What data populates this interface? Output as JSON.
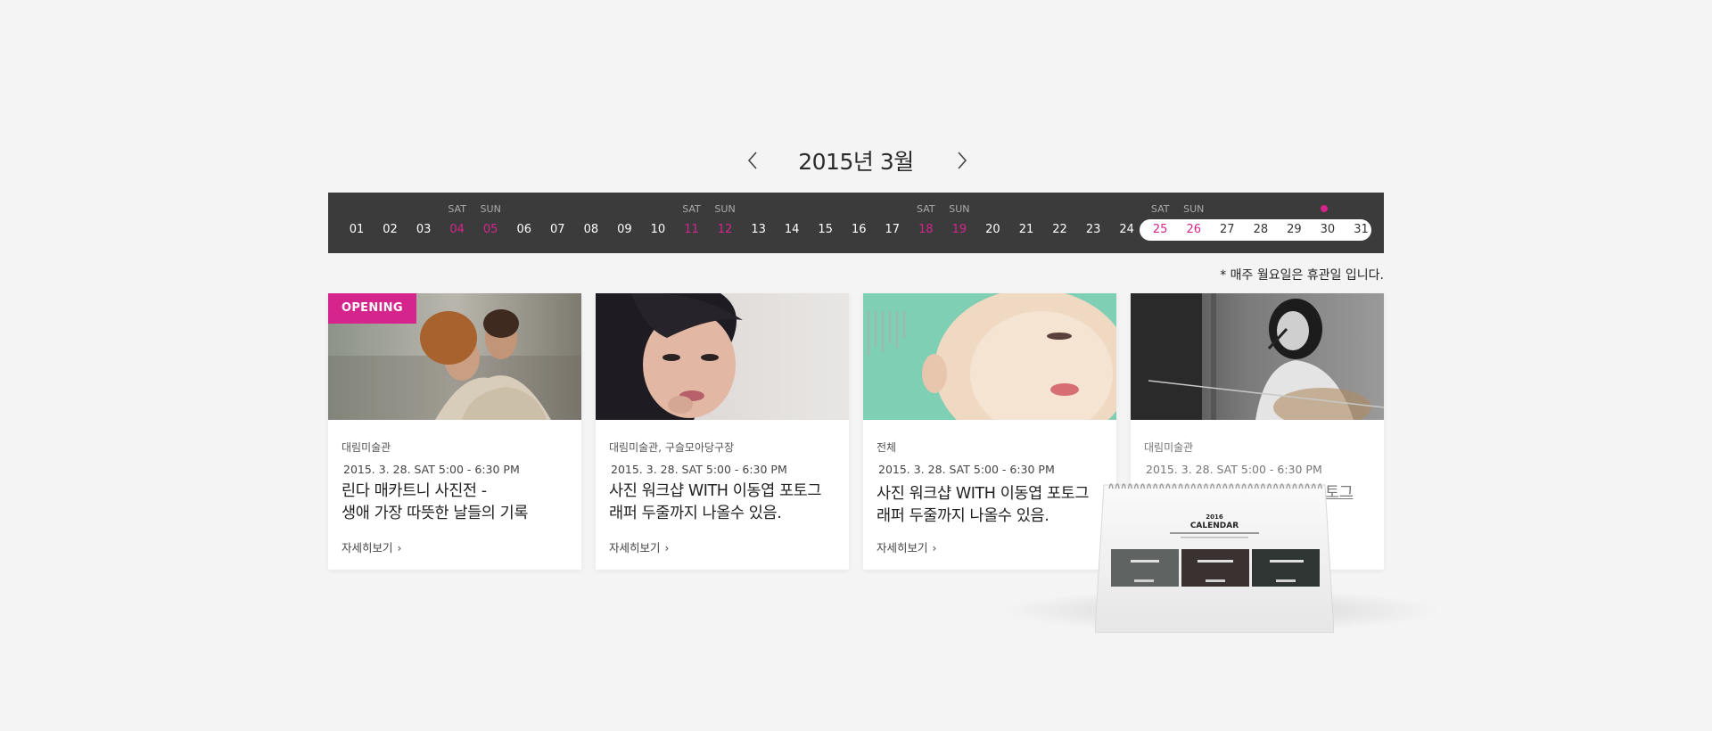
{
  "header": {
    "month_title": "2015년 3월",
    "prev_icon": "chevron-left-icon",
    "next_icon": "chevron-right-icon"
  },
  "calendar": {
    "days": [
      {
        "num": "01",
        "name": ""
      },
      {
        "num": "02",
        "name": ""
      },
      {
        "num": "03",
        "name": ""
      },
      {
        "num": "04",
        "name": "SAT"
      },
      {
        "num": "05",
        "name": "SUN"
      },
      {
        "num": "06",
        "name": ""
      },
      {
        "num": "07",
        "name": ""
      },
      {
        "num": "08",
        "name": ""
      },
      {
        "num": "09",
        "name": ""
      },
      {
        "num": "10",
        "name": ""
      },
      {
        "num": "11",
        "name": "SAT"
      },
      {
        "num": "12",
        "name": "SUN"
      },
      {
        "num": "13",
        "name": ""
      },
      {
        "num": "14",
        "name": ""
      },
      {
        "num": "15",
        "name": ""
      },
      {
        "num": "16",
        "name": ""
      },
      {
        "num": "17",
        "name": ""
      },
      {
        "num": "18",
        "name": "SAT"
      },
      {
        "num": "19",
        "name": "SUN"
      },
      {
        "num": "20",
        "name": ""
      },
      {
        "num": "21",
        "name": ""
      },
      {
        "num": "22",
        "name": ""
      },
      {
        "num": "23",
        "name": ""
      },
      {
        "num": "24",
        "name": ""
      },
      {
        "num": "25",
        "name": "SAT"
      },
      {
        "num": "26",
        "name": "SUN"
      },
      {
        "num": "27",
        "name": ""
      },
      {
        "num": "28",
        "name": ""
      },
      {
        "num": "29",
        "name": ""
      },
      {
        "num": "30",
        "name": ""
      },
      {
        "num": "31",
        "name": ""
      }
    ],
    "selected_range": [
      "25",
      "31"
    ],
    "event_day": "30",
    "closed_note": "* 매주 월요일은 휴관일 입니다."
  },
  "cards": [
    {
      "badge": "OPENING",
      "venue": "대림미술관",
      "time": "2015. 3. 28. SAT 5:00 - 6:30 PM",
      "title_line1": "린다 매카트니 사진전 -",
      "title_line2": "생애 가장 따뜻한 날들의 기록",
      "more": "자세히보기"
    },
    {
      "venue": "대림미술관, 구슬모아당구장",
      "time": "2015. 3. 28. SAT 5:00 - 6:30 PM",
      "title_line1": "사진 워크샵 WITH 이동엽 포토그",
      "title_line2": "래퍼 두줄까지 나올수 있음.",
      "more": "자세히보기"
    },
    {
      "venue": "전체",
      "time": "2015. 3. 28. SAT 5:00 - 6:30 PM",
      "title_line1": "사진 워크샵 WITH 이동엽 포토그",
      "title_line2": "래퍼 두줄까지 나올수 있음.",
      "more": "자세히보기"
    },
    {
      "venue": "대림미술관",
      "time": "2015. 3. 28. SAT 5:00 - 6:30 PM",
      "title_line1": "토그"
    }
  ],
  "desk_calendar": {
    "year": "2016",
    "label": "CALENDAR"
  },
  "colors": {
    "accent": "#d6248d",
    "bar": "#3b3b3b",
    "background": "#f4f4f4"
  }
}
